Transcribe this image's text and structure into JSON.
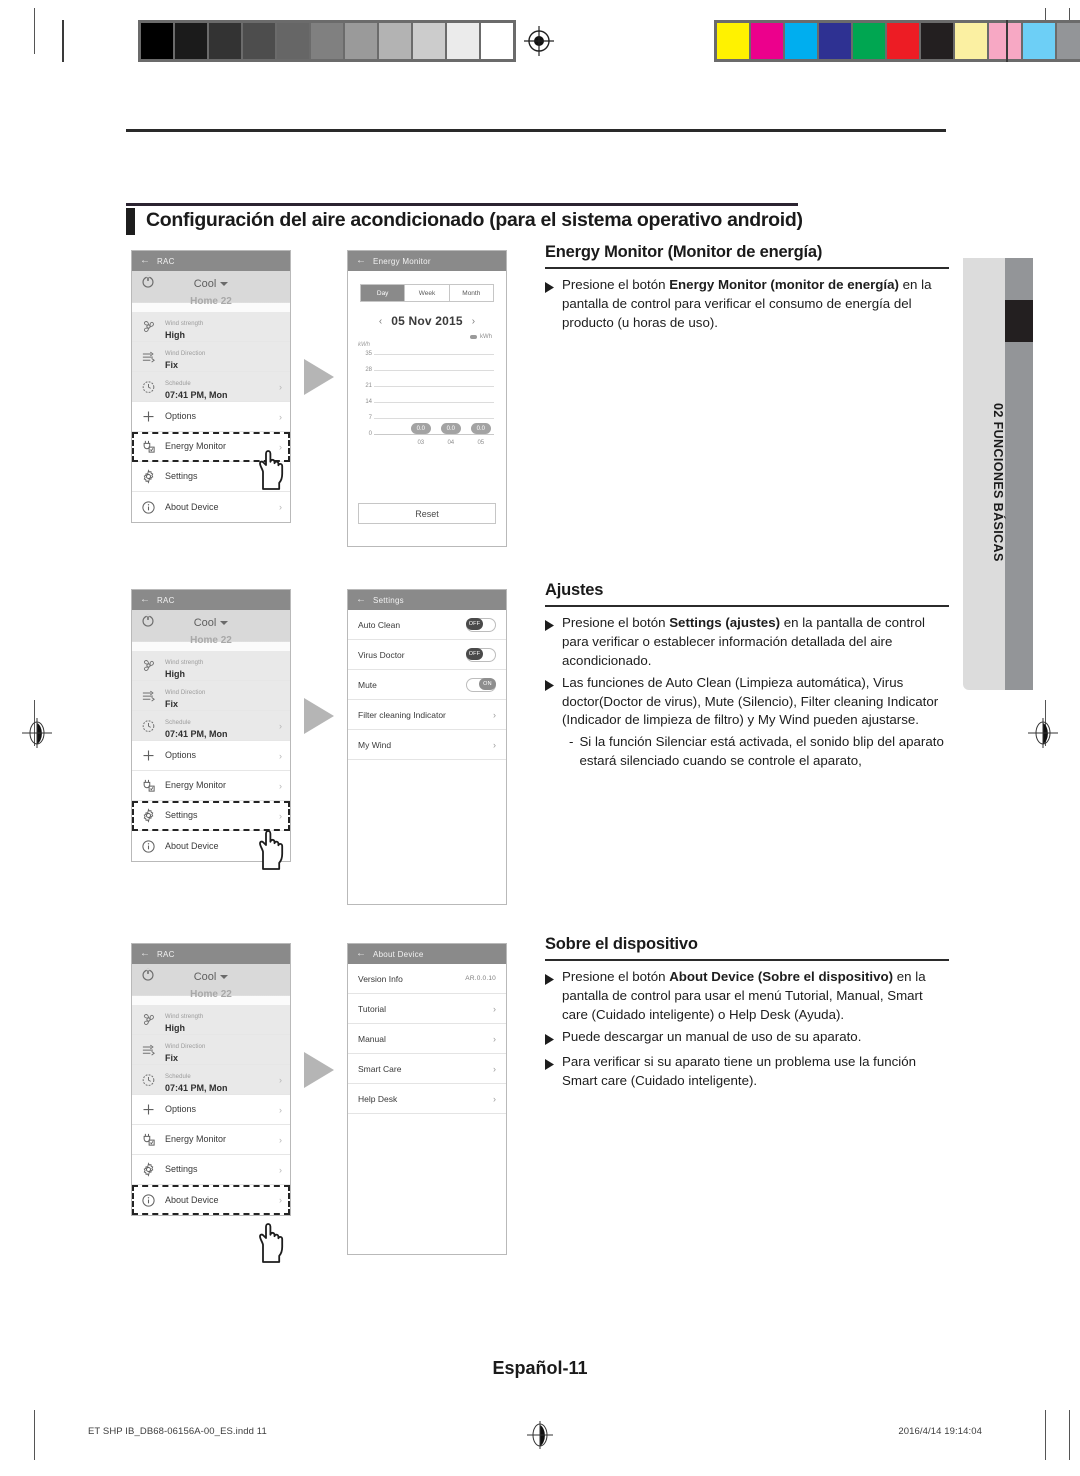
{
  "chapter": {
    "title": "Configuración del aire acondicionado (para el sistema operativo android)"
  },
  "side_tab": {
    "label": "02  FUNCIONES BÁSICAS"
  },
  "phone_control": {
    "header_title": "RAC",
    "mode": "Cool",
    "temp_ghost": "Home 22",
    "rows": [
      {
        "small": "Wind strength",
        "large": "High",
        "icon": "fan-icon"
      },
      {
        "small": "Wind Direction",
        "large": "Fix",
        "icon": "wind-direction-icon"
      },
      {
        "small": "Schedule",
        "large": "07:41 PM, Mon",
        "icon": "clock-icon"
      }
    ],
    "menu": [
      {
        "label": "Options",
        "icon": "plus-icon"
      },
      {
        "label": "Energy Monitor",
        "icon": "plug-icon"
      },
      {
        "label": "Settings",
        "icon": "gear-icon"
      },
      {
        "label": "About Device",
        "icon": "info-icon"
      }
    ]
  },
  "energy_monitor": {
    "header_title": "Energy Monitor",
    "segments": [
      "Day",
      "Week",
      "Month"
    ],
    "selected_segment": "Day",
    "date": "05 Nov 2015",
    "prev_arrow": "‹",
    "next_arrow": "›",
    "legend_label": "kWh",
    "reset_label": "Reset"
  },
  "chart_data": {
    "type": "bar",
    "title": "",
    "categories": [
      "03",
      "04",
      "05"
    ],
    "values": [
      0.0,
      0.0,
      0.0
    ],
    "data_labels": [
      "0.0",
      "0.0",
      "0.0"
    ],
    "ylabel": "kWh",
    "xlabel": "",
    "yticks": [
      0,
      7,
      14,
      21,
      28,
      35
    ],
    "ylim": [
      0,
      35
    ],
    "grid": true,
    "legend": [
      "kWh"
    ],
    "legend_position": "top-right"
  },
  "settings_screen": {
    "header_title": "Settings",
    "rows": [
      {
        "label": "Auto Clean",
        "control": "toggle",
        "state": "OFF"
      },
      {
        "label": "Virus Doctor",
        "control": "toggle",
        "state": "OFF"
      },
      {
        "label": "Mute",
        "control": "toggle",
        "state": "ON"
      },
      {
        "label": "Filter cleaning Indicator",
        "control": "chevron",
        "state": "›"
      },
      {
        "label": "My Wind",
        "control": "chevron",
        "state": "›"
      }
    ]
  },
  "about_screen": {
    "header_title": "About Device",
    "rows": [
      {
        "label": "Version Info",
        "control": "value",
        "state": "AR.0.0.10"
      },
      {
        "label": "Tutorial",
        "control": "chevron",
        "state": "›"
      },
      {
        "label": "Manual",
        "control": "chevron",
        "state": "›"
      },
      {
        "label": "Smart Care",
        "control": "chevron",
        "state": "›"
      },
      {
        "label": "Help Desk",
        "control": "chevron",
        "state": "›"
      }
    ]
  },
  "sections": [
    {
      "heading": "Energy Monitor (Monitor de energía)",
      "bullets": [
        {
          "lead": "Presione el botón ",
          "bold": "Energy Monitor (monitor de energía)",
          "rest": " en la pantalla de control para verificar el consumo de energía del producto (u  horas de uso)."
        }
      ],
      "subitems": []
    },
    {
      "heading": "Ajustes",
      "bullets": [
        {
          "lead": "Presione el botón ",
          "bold": "Settings (ajustes)",
          "rest": " en la pantalla de control para verificar o establecer información detallada del aire acondicionado."
        },
        {
          "lead": "Las funciones de Auto Clean (Limpieza automática), Virus doctor(Doctor de virus), Mute (Silencio), Filter cleaning Indicator (Indicador de limpieza de filtro) y My Wind pueden ajustarse.",
          "bold": "",
          "rest": ""
        }
      ],
      "subitems": [
        {
          "dash": "-",
          "text": "Si la función Silenciar está activada, el sonido blip del aparato estará silenciado cuando se controle el aparato,"
        }
      ]
    },
    {
      "heading": "Sobre el dispositivo",
      "bullets": [
        {
          "lead": "Presione el botón ",
          "bold": "About Device (Sobre el dispositivo)",
          "rest": " en la pantalla de control para usar el menú Tutorial, Manual, Smart care (Cuidado inteligente) o Help Desk (Ayuda)."
        },
        {
          "lead": "Puede descargar un manual de uso de su aparato.",
          "bold": "",
          "rest": ""
        },
        {
          "lead": "Para verificar si su aparato tiene un problema use la función Smart care (Cuidado inteligente).",
          "bold": "",
          "rest": ""
        }
      ],
      "subitems": []
    }
  ],
  "footer": {
    "page_label": "Español-11",
    "file_name": "ET SHP IB_DB68-06156A-00_ES.indd   11",
    "timestamp": "2016/4/14   19:14:04"
  },
  "calibration": {
    "grayscale": [
      "#000000",
      "#1b1b1b",
      "#333333",
      "#4d4d4d",
      "#666666",
      "#808080",
      "#9a9a9a",
      "#b3b3b3",
      "#cccccc",
      "#ebebeb",
      "#ffffff"
    ],
    "colors": [
      "#fff200",
      "#ec008c",
      "#00aeef",
      "#2e3192",
      "#00a651",
      "#ed1c24",
      "#231f20",
      "#fbf0a2",
      "#f7a8c4",
      "#6dcff6",
      "#939598"
    ]
  }
}
